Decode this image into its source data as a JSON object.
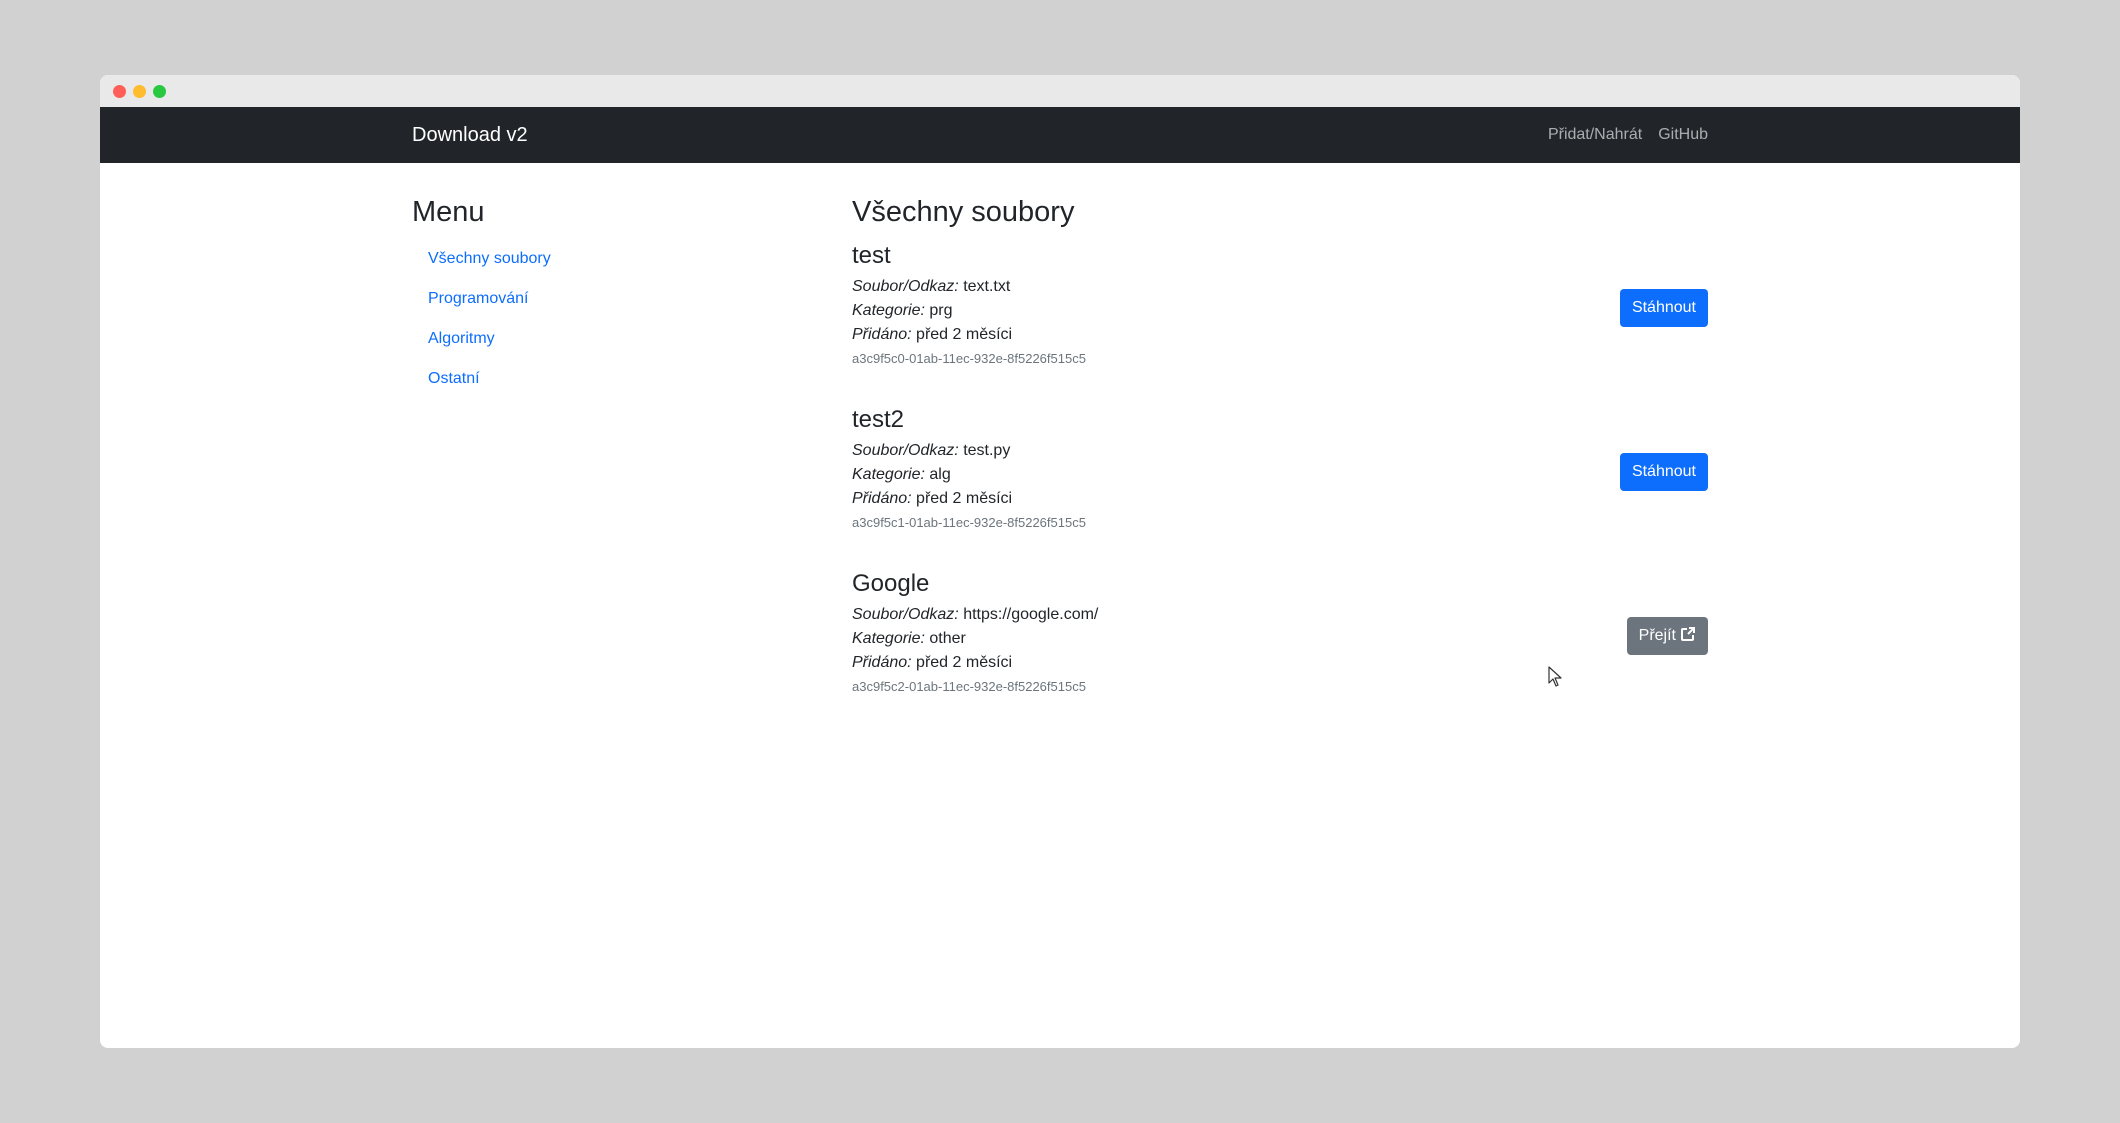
{
  "navbar": {
    "brand": "Download v2",
    "links": [
      "Přidat/Nahrát",
      "GitHub"
    ]
  },
  "sidebar": {
    "title": "Menu",
    "items": [
      "Všechny soubory",
      "Programování",
      "Algoritmy",
      "Ostatní"
    ]
  },
  "main": {
    "title": "Všechny soubory",
    "labels": {
      "file": "Soubor/Odkaz:",
      "category": "Kategorie:",
      "added": "Přidáno:"
    },
    "files": [
      {
        "title": "test",
        "file": "text.txt",
        "category": "prg",
        "added": "před 2 měsíci",
        "uuid": "a3c9f5c0-01ab-11ec-932e-8f5226f515c5",
        "action": "Stáhnout"
      },
      {
        "title": "test2",
        "file": "test.py",
        "category": "alg",
        "added": "před 2 měsíci",
        "uuid": "a3c9f5c1-01ab-11ec-932e-8f5226f515c5",
        "action": "Stáhnout"
      },
      {
        "title": "Google",
        "file": "https://google.com/",
        "category": "other",
        "added": "před 2 měsíci",
        "uuid": "a3c9f5c2-01ab-11ec-932e-8f5226f515c5",
        "action": "Přejít"
      }
    ]
  },
  "colors": {
    "navbar_bg": "#212529",
    "primary": "#0d6efd",
    "secondary": "#6c757d"
  },
  "icons": {
    "external_link": "external-link-icon"
  }
}
